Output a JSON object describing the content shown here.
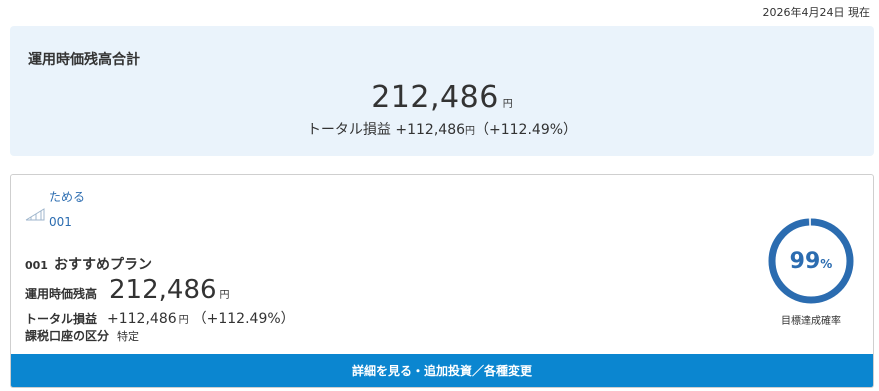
{
  "as_of": "2026年4月24日 現在",
  "summary": {
    "title": "運用時価残高合計",
    "value": "212,486",
    "unit": "円",
    "pl_label": "トータル損益",
    "pl_value": "+112,486",
    "pl_unit": "円",
    "pl_percent": "（+112.49%）"
  },
  "goal": {
    "name": "ためる",
    "code": "001",
    "icon": "chart-trend-icon"
  },
  "plan": {
    "code": "001",
    "name": "おすすめプラン",
    "value_label": "運用時価残高",
    "value": "212,486",
    "unit": "円",
    "pl_label": "トータル損益",
    "pl_value": "+112,486",
    "pl_unit": "円",
    "pl_percent": "（+112.49%）",
    "tax_label": "課税口座の区分",
    "tax_value": "特定"
  },
  "achievement": {
    "value": "99",
    "percent_sign": "%",
    "progress": 0.99,
    "caption": "目標達成確率",
    "color": "#2b6cb0",
    "track_color": "#dfe7f1"
  },
  "detail_button": "詳細を見る・追加投資／各種変更",
  "colors": {
    "summary_bg": "#eaf3fb",
    "link": "#2b6cb0",
    "button": "#0b86d0"
  }
}
